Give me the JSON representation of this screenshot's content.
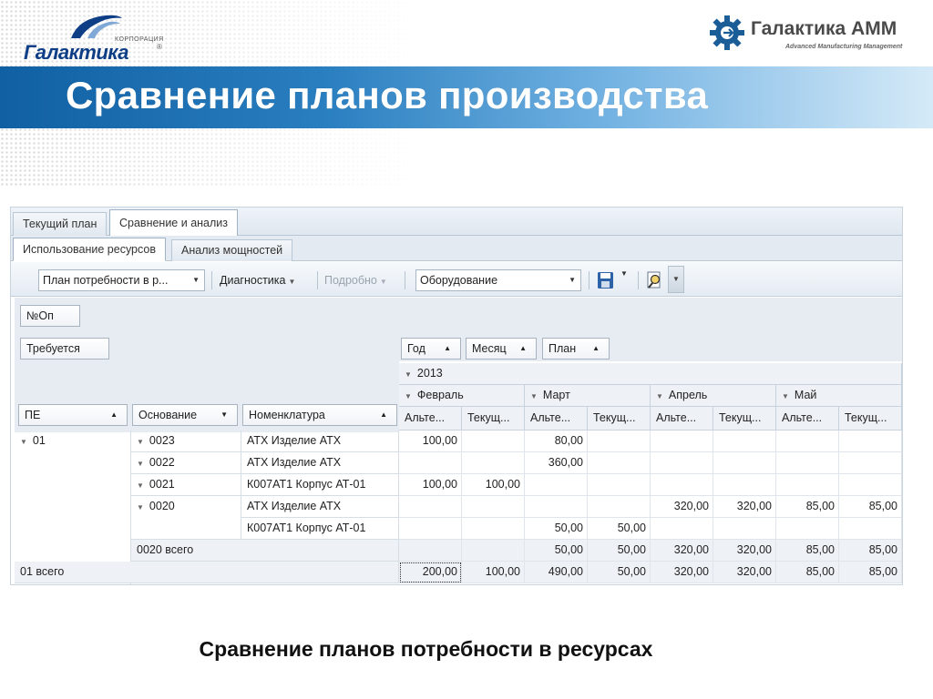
{
  "slide": {
    "title": "Сравнение планов производства",
    "subtitle": "Сравнение планов потребности в ресурсах",
    "logo_left": {
      "small": "КОРПОРАЦИЯ",
      "name": "Галактика",
      "mark": "®"
    },
    "logo_right": {
      "name": "Галактика АММ",
      "tagline": "Advanced Manufacturing Management"
    }
  },
  "tabs_main": [
    {
      "label": "Текущий план",
      "active": false
    },
    {
      "label": "Сравнение и анализ",
      "active": true
    }
  ],
  "tabs_sub": [
    {
      "label": "Использование ресурсов",
      "active": true
    },
    {
      "label": "Анализ мощностей",
      "active": false
    }
  ],
  "toolbar": {
    "plan_combo": "План потребности в р...",
    "diagnostics": "Диагностика",
    "details": "Подробно",
    "equipment_combo": "Оборудование",
    "save_icon": "floppy-disk-icon",
    "preview_icon": "print-preview-icon"
  },
  "pivot": {
    "filter_field": "№Оп",
    "data_field": "Требуется",
    "column_fields": [
      {
        "label": "Год",
        "sort": "▲"
      },
      {
        "label": "Месяц",
        "sort": "▲"
      },
      {
        "label": "План",
        "sort": "▲"
      }
    ],
    "row_fields": [
      {
        "label": "ПЕ",
        "sort": "▲"
      },
      {
        "label": "Основание",
        "sort": "▼"
      },
      {
        "label": "Номенклатура",
        "sort": "▲"
      }
    ],
    "year": "2013",
    "months": [
      "Февраль",
      "Март",
      "Апрель",
      "Май"
    ],
    "plan_headers": [
      "Альте...",
      "Текущ...",
      "Альте...",
      "Текущ...",
      "Альте...",
      "Текущ...",
      "Альте...",
      "Текущ..."
    ],
    "pe": "01",
    "pe_total_label": "01 всего",
    "bases": [
      {
        "label": "0023",
        "items": [
          "АТХ Изделие АТХ"
        ]
      },
      {
        "label": "0022",
        "items": [
          "АТХ Изделие АТХ"
        ]
      },
      {
        "label": "0021",
        "items": [
          "К007АТ1 Корпус АТ-01"
        ]
      },
      {
        "label": "0020",
        "items": [
          "АТХ Изделие АТХ",
          "К007АТ1 Корпус АТ-01"
        ]
      }
    ],
    "subtotal_label": "0020 всего",
    "rows": [
      [
        "100,00",
        "",
        "80,00",
        "",
        "",
        "",
        "",
        ""
      ],
      [
        "",
        "",
        "360,00",
        "",
        "",
        "",
        "",
        ""
      ],
      [
        "100,00",
        "100,00",
        "",
        "",
        "",
        "",
        "",
        ""
      ],
      [
        "",
        "",
        "",
        "",
        "320,00",
        "320,00",
        "85,00",
        "85,00"
      ],
      [
        "",
        "",
        "50,00",
        "50,00",
        "",
        "",
        "",
        ""
      ],
      [
        "",
        "",
        "50,00",
        "50,00",
        "320,00",
        "320,00",
        "85,00",
        "85,00"
      ],
      [
        "200,00",
        "100,00",
        "490,00",
        "50,00",
        "320,00",
        "320,00",
        "85,00",
        "85,00"
      ]
    ]
  }
}
